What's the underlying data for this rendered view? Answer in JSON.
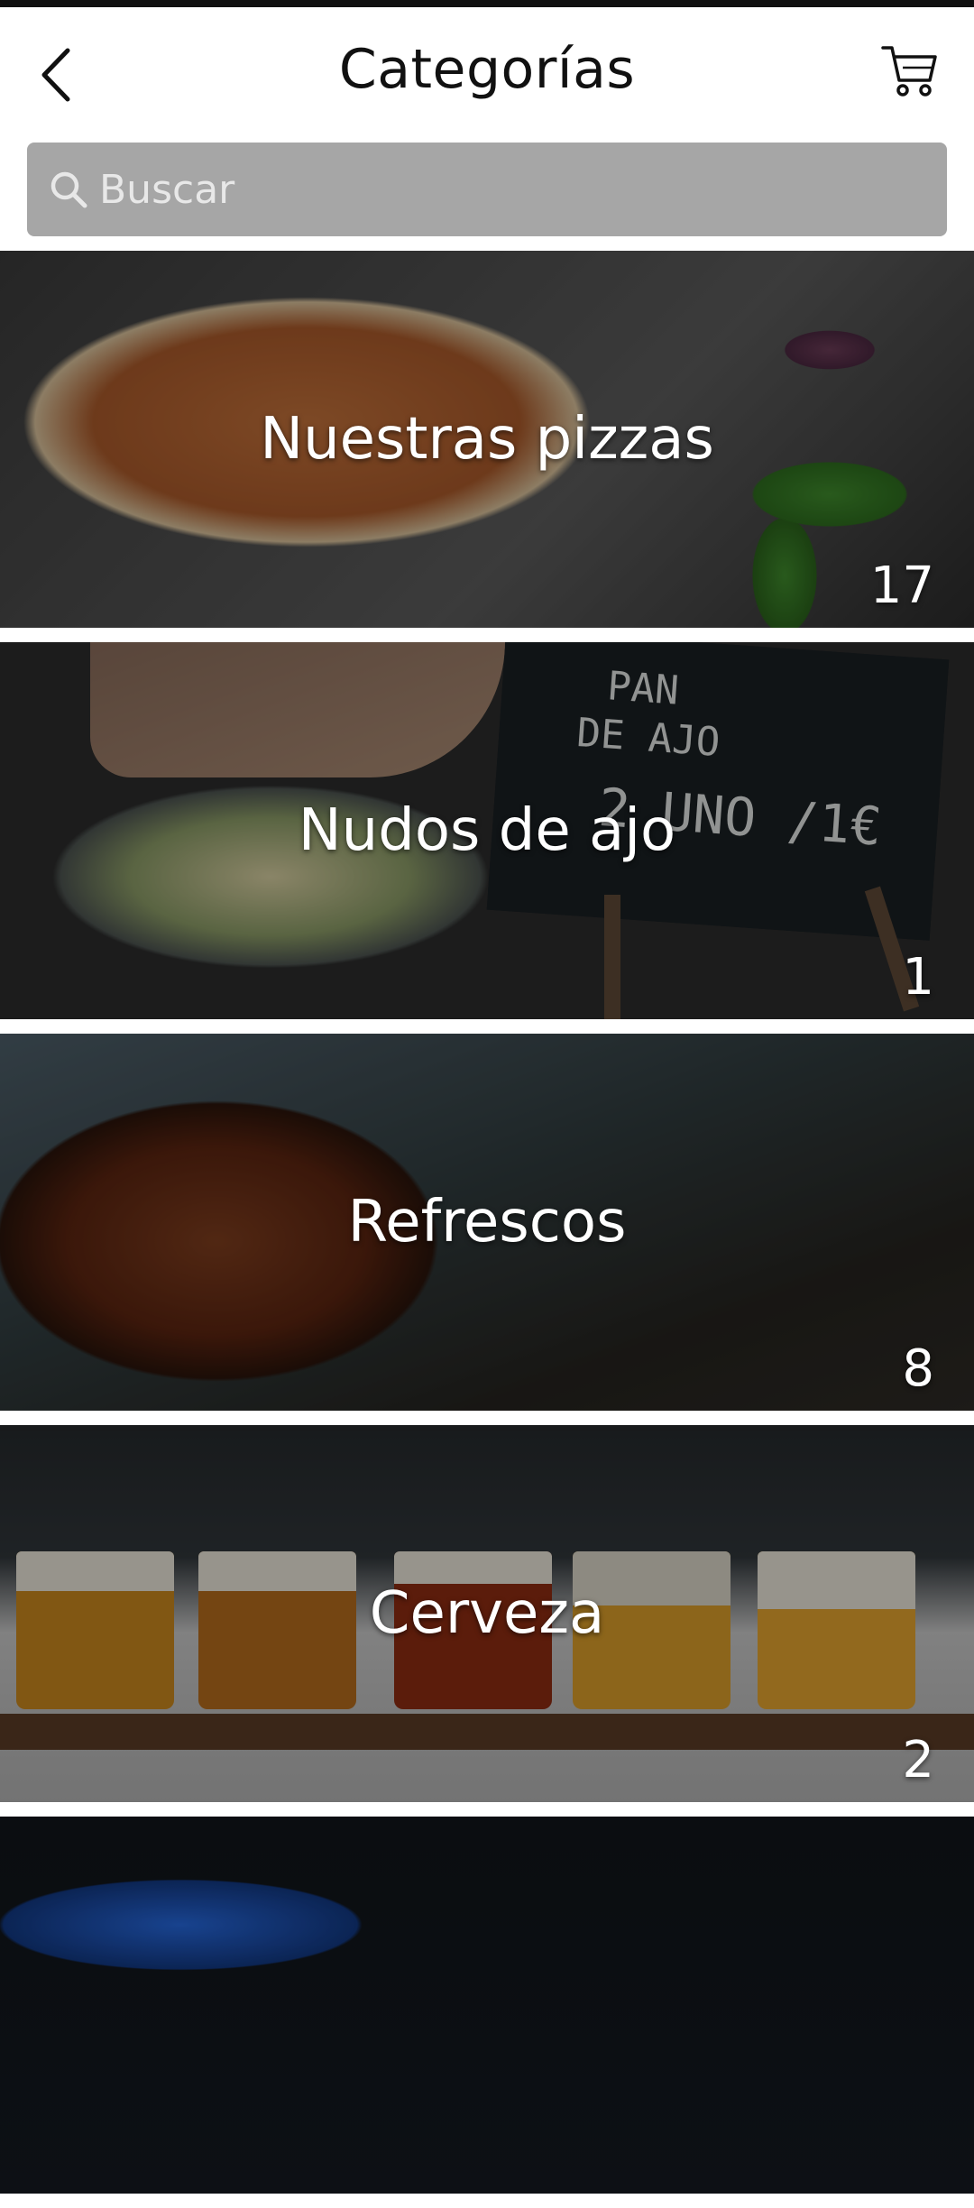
{
  "header": {
    "title": "Categorías"
  },
  "search": {
    "placeholder": "Buscar"
  },
  "categories": [
    {
      "name": "Nuestras pizzas",
      "count": "17"
    },
    {
      "name": "Nudos de ajo",
      "count": "1"
    },
    {
      "name": "Refrescos",
      "count": "8"
    },
    {
      "name": "Cerveza",
      "count": "2"
    },
    {
      "name": "",
      "count": ""
    }
  ],
  "chalkboard": {
    "line1": "PAN",
    "line2": "DE AJO",
    "line3": "2 UNO /1€"
  },
  "colors": {
    "search_bg": "#a6a6a6",
    "title_text": "#111111",
    "card_text": "#ffffff"
  },
  "icons": {
    "back": "chevron-left-icon",
    "cart": "cart-icon",
    "search": "search-icon"
  }
}
